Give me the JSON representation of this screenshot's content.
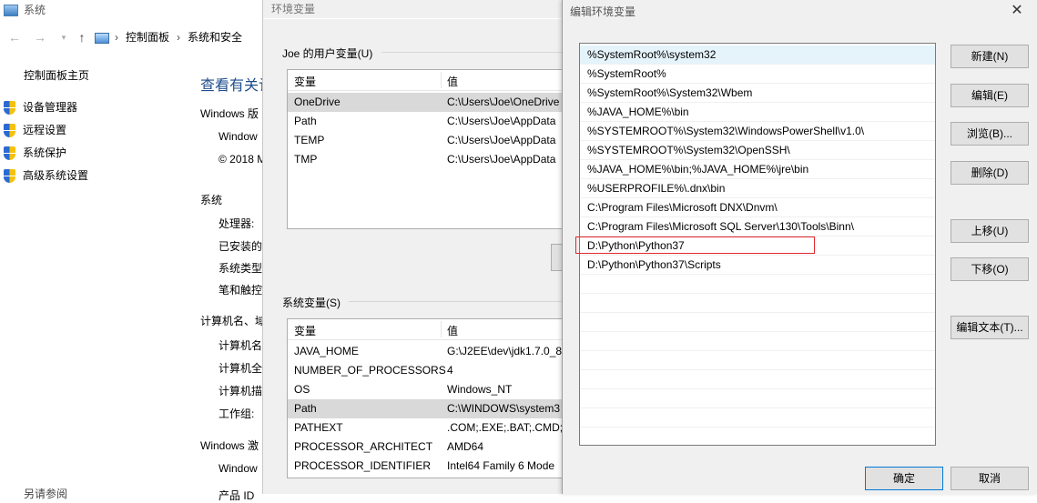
{
  "system_window": {
    "title": "系统",
    "address": {
      "crumb1": "控制面板",
      "crumb2": "系统和安全"
    },
    "left_nav": {
      "home": "控制面板主页",
      "items": [
        "设备管理器",
        "远程设置",
        "系统保护",
        "高级系统设置"
      ]
    },
    "heading": "查看有关计",
    "windows_edition": "Windows 版",
    "edition_name": "Window",
    "copyright": "© 2018 M",
    "system_section": "系统",
    "system_fields": [
      "处理器:",
      "已安装的",
      "系统类型:",
      "笔和触控:"
    ],
    "computer_section": "计算机名、域",
    "computer_fields": [
      "计算机名:",
      "计算机全",
      "计算机描",
      "工作组:"
    ],
    "activation_section": "Windows 激",
    "activation_value": "Window",
    "see_also": "另请参阅",
    "product_id": "产品 ID"
  },
  "env_dialog": {
    "title": "环境变量",
    "user_group_label": "Joe 的用户变量(U)",
    "user_vars": {
      "headers": [
        "变量",
        "值"
      ],
      "rows": [
        [
          "OneDrive",
          "C:\\Users\\Joe\\OneDrive"
        ],
        [
          "Path",
          "C:\\Users\\Joe\\AppData"
        ],
        [
          "TEMP",
          "C:\\Users\\Joe\\AppData"
        ],
        [
          "TMP",
          "C:\\Users\\Joe\\AppData"
        ]
      ]
    },
    "system_group_label": "系统变量(S)",
    "system_vars": {
      "headers": [
        "变量",
        "值"
      ],
      "rows": [
        [
          "JAVA_HOME",
          "G:\\J2EE\\dev\\jdk1.7.0_8"
        ],
        [
          "NUMBER_OF_PROCESSORS",
          "4"
        ],
        [
          "OS",
          "Windows_NT"
        ],
        [
          "Path",
          "C:\\WINDOWS\\system3"
        ],
        [
          "PATHEXT",
          ".COM;.EXE;.BAT;.CMD;"
        ],
        [
          "PROCESSOR_ARCHITECT",
          "AMD64"
        ],
        [
          "PROCESSOR_IDENTIFIER",
          "Intel64 Family 6 Mode"
        ]
      ]
    }
  },
  "edit_dialog": {
    "title": "编辑环境变量",
    "close": "✕",
    "entries": [
      "%SystemRoot%\\system32",
      "%SystemRoot%",
      "%SystemRoot%\\System32\\Wbem",
      "%JAVA_HOME%\\bin",
      "%SYSTEMROOT%\\System32\\WindowsPowerShell\\v1.0\\",
      "%SYSTEMROOT%\\System32\\OpenSSH\\",
      "%JAVA_HOME%\\bin;%JAVA_HOME%\\jre\\bin",
      "%USERPROFILE%\\.dnx\\bin",
      "C:\\Program Files\\Microsoft DNX\\Dnvm\\",
      "C:\\Program Files\\Microsoft SQL Server\\130\\Tools\\Binn\\",
      "D:\\Python\\Python37",
      "D:\\Python\\Python37\\Scripts"
    ],
    "buttons": {
      "new": "新建(N)",
      "edit": "编辑(E)",
      "browse": "浏览(B)...",
      "delete": "删除(D)",
      "move_up": "上移(U)",
      "move_down": "下移(O)",
      "edit_text": "编辑文本(T)...",
      "ok": "确定",
      "cancel": "取消"
    },
    "highlight_color": "#e0282e"
  }
}
